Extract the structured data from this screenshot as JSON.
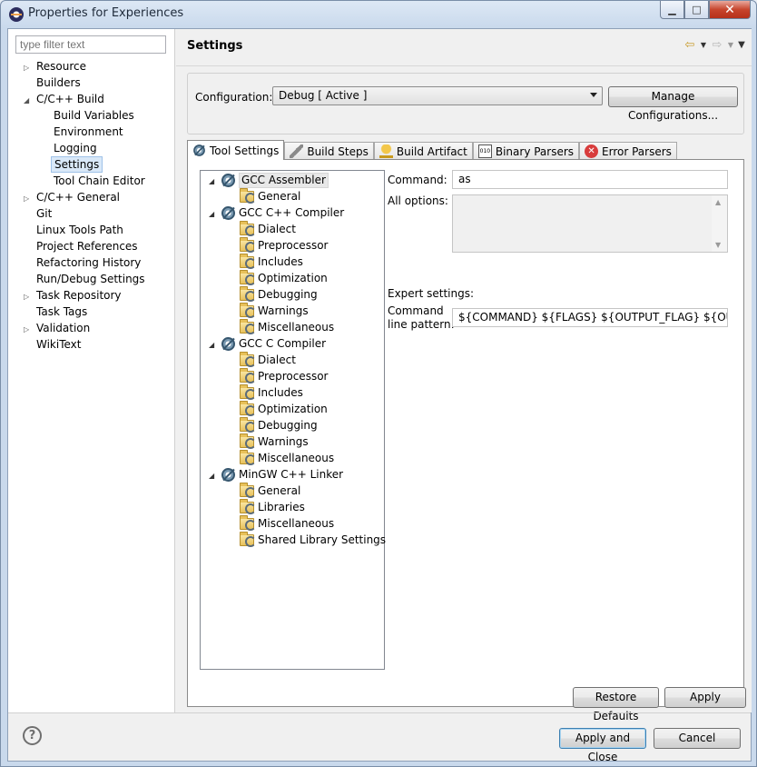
{
  "window": {
    "title": "Properties for Experiences"
  },
  "filter": {
    "placeholder": "type filter text"
  },
  "nav": {
    "items": [
      {
        "label": "Resource"
      },
      {
        "label": "Builders"
      },
      {
        "label": "C/C++ Build"
      },
      {
        "label": "Build Variables"
      },
      {
        "label": "Environment"
      },
      {
        "label": "Logging"
      },
      {
        "label": "Settings"
      },
      {
        "label": "Tool Chain Editor"
      },
      {
        "label": "C/C++ General"
      },
      {
        "label": "Git"
      },
      {
        "label": "Linux Tools Path"
      },
      {
        "label": "Project References"
      },
      {
        "label": "Refactoring History"
      },
      {
        "label": "Run/Debug Settings"
      },
      {
        "label": "Task Repository"
      },
      {
        "label": "Task Tags"
      },
      {
        "label": "Validation"
      },
      {
        "label": "WikiText"
      }
    ]
  },
  "page": {
    "title": "Settings"
  },
  "config": {
    "label": "Configuration:",
    "value": "Debug  [ Active ]",
    "manage_label": "Manage Configurations..."
  },
  "tabs": [
    {
      "label": "Tool Settings"
    },
    {
      "label": "Build Steps"
    },
    {
      "label": "Build Artifact"
    },
    {
      "label": "Binary Parsers"
    },
    {
      "label": "Error Parsers"
    }
  ],
  "tool_tree": [
    {
      "label": "GCC Assembler"
    },
    {
      "label": "General"
    },
    {
      "label": "GCC C++ Compiler"
    },
    {
      "label": "Dialect"
    },
    {
      "label": "Preprocessor"
    },
    {
      "label": "Includes"
    },
    {
      "label": "Optimization"
    },
    {
      "label": "Debugging"
    },
    {
      "label": "Warnings"
    },
    {
      "label": "Miscellaneous"
    },
    {
      "label": "GCC C Compiler"
    },
    {
      "label": "Dialect"
    },
    {
      "label": "Preprocessor"
    },
    {
      "label": "Includes"
    },
    {
      "label": "Optimization"
    },
    {
      "label": "Debugging"
    },
    {
      "label": "Warnings"
    },
    {
      "label": "Miscellaneous"
    },
    {
      "label": "MinGW C++ Linker"
    },
    {
      "label": "General"
    },
    {
      "label": "Libraries"
    },
    {
      "label": "Miscellaneous"
    },
    {
      "label": "Shared Library Settings"
    }
  ],
  "settings": {
    "command_label": "Command:",
    "command_value": "as",
    "all_options_label": "All options:",
    "expert_label": "Expert settings:",
    "pattern_label_1": "Command",
    "pattern_label_2": "line pattern:",
    "pattern_value": "${COMMAND} ${FLAGS} ${OUTPUT_FLAG} ${OUTPUT_PREFIX}${OUTPUT} ${INPUTS}"
  },
  "buttons": {
    "restore_defaults": "Restore Defaults",
    "apply": "Apply",
    "apply_and_close": "Apply and Close",
    "cancel": "Cancel"
  }
}
